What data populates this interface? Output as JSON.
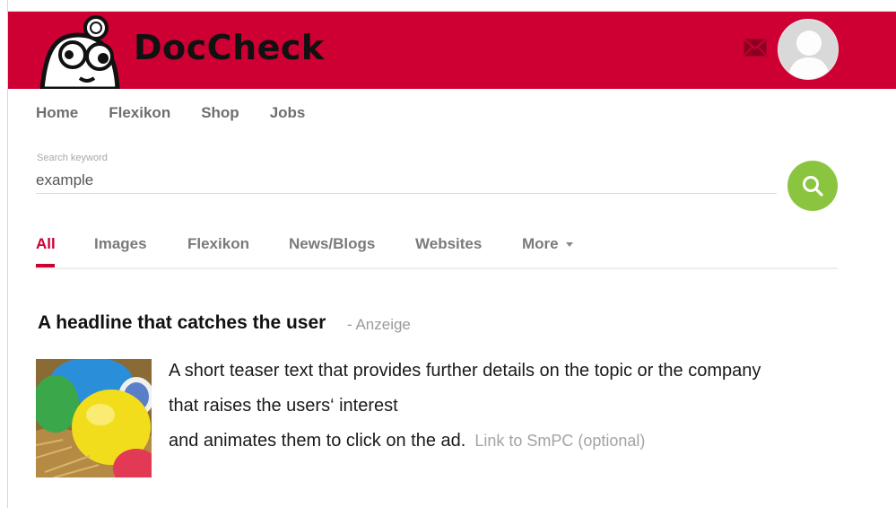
{
  "header": {
    "brand": "DocCheck",
    "icons": {
      "mail": "mail-icon",
      "avatar": "user-avatar-icon"
    },
    "color": "#ce0033"
  },
  "nav": {
    "items": [
      {
        "label": "Home"
      },
      {
        "label": "Flexikon"
      },
      {
        "label": "Shop"
      },
      {
        "label": "Jobs"
      }
    ]
  },
  "search": {
    "label": "Search keyword",
    "value": "example",
    "button_color": "#8bc53f"
  },
  "tabs": {
    "items": [
      {
        "label": "All",
        "active": true
      },
      {
        "label": "Images"
      },
      {
        "label": "Flexikon"
      },
      {
        "label": "News/Blogs"
      },
      {
        "label": "Websites"
      },
      {
        "label": "More"
      }
    ]
  },
  "ad": {
    "headline": "A headline that catches the user",
    "tag": "- Anzeige",
    "text_lines": [
      "A short teaser text that provides further details on the topic or the company",
      "that raises the users‘ interest",
      "and animates them to click on the ad."
    ],
    "smpc_link": "Link to SmPC (optional)"
  }
}
